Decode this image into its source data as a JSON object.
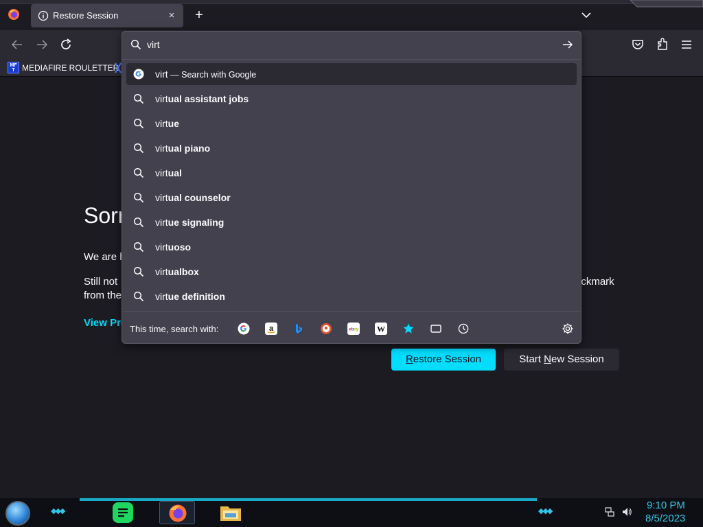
{
  "browser": {
    "tab": {
      "title": "Restore Session",
      "close": "×"
    },
    "new_tab": "+",
    "bookmark": {
      "icon_text": "MF\nT",
      "label": "MEDIAFIRE ROULETTER"
    }
  },
  "urlbar": {
    "value": "virt",
    "primary": {
      "query": "virt",
      "sep": " — ",
      "action": "Search with Google"
    },
    "suggestions": [
      {
        "typed": "virt",
        "completion": "ual assistant jobs"
      },
      {
        "typed": "virt",
        "completion": "ue"
      },
      {
        "typed": "virt",
        "completion": "ual piano"
      },
      {
        "typed": "virt",
        "completion": "ual"
      },
      {
        "typed": "virt",
        "completion": "ual counselor"
      },
      {
        "typed": "virt",
        "completion": "ue signaling"
      },
      {
        "typed": "virt",
        "completion": "uoso"
      },
      {
        "typed": "virt",
        "completion": "ualbox"
      },
      {
        "typed": "virt",
        "completion": "ue definition"
      }
    ],
    "oneoff_label": "This time, search with:",
    "engines": [
      "google-icon",
      "amazon-icon",
      "bing-icon",
      "duckduckgo-icon",
      "ebay-icon",
      "wikipedia-icon",
      "bookmarks-star-icon",
      "tabs-icon",
      "history-icon"
    ]
  },
  "page": {
    "title": "Sorr",
    "p1": "We are h",
    "p2_left": "Still not",
    "p2_right": "eckmark",
    "p2_line2": "from the",
    "link": "View Pre",
    "restore_button": {
      "before": "",
      "underline": "R",
      "after": "estore Session"
    },
    "start_new_button": {
      "before": "Start ",
      "underline": "N",
      "after": "ew Session"
    }
  },
  "taskbar": {
    "time": "9:10 PM",
    "date": "8/5/2023"
  },
  "colors": {
    "accent": "#00ddff",
    "popup_bg": "#42414d",
    "page_bg": "#1c1b22",
    "toolbar_bg": "#2b2a33",
    "taskbar_accent": "#2cc7e8"
  }
}
